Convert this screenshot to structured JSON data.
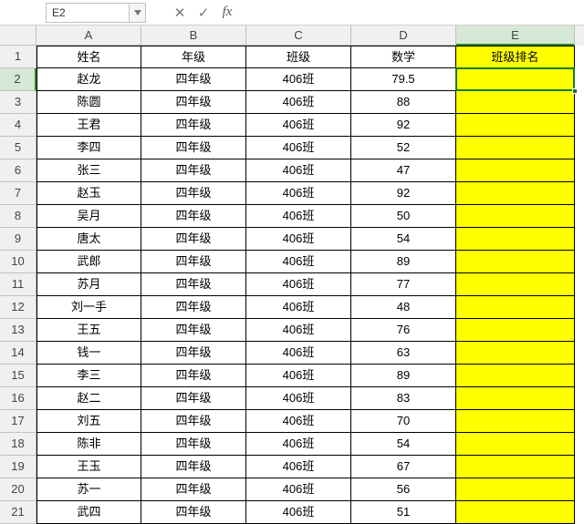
{
  "formula_bar": {
    "name_box": "E2",
    "cancel_glyph": "✕",
    "accept_glyph": "✓",
    "fx_label": "fx",
    "formula": ""
  },
  "columns": [
    "A",
    "B",
    "C",
    "D",
    "E"
  ],
  "selected_col": 4,
  "selected_row": 1,
  "headers": [
    "姓名",
    "年级",
    "班级",
    "数学",
    "班级排名"
  ],
  "rows": [
    {
      "n": "赵龙",
      "g": "四年级",
      "c": "406班",
      "m": "79.5",
      "r": ""
    },
    {
      "n": "陈圆",
      "g": "四年级",
      "c": "406班",
      "m": "88",
      "r": ""
    },
    {
      "n": "王君",
      "g": "四年级",
      "c": "406班",
      "m": "92",
      "r": ""
    },
    {
      "n": "李四",
      "g": "四年级",
      "c": "406班",
      "m": "52",
      "r": ""
    },
    {
      "n": "张三",
      "g": "四年级",
      "c": "406班",
      "m": "47",
      "r": ""
    },
    {
      "n": "赵玉",
      "g": "四年级",
      "c": "406班",
      "m": "92",
      "r": ""
    },
    {
      "n": "吴月",
      "g": "四年级",
      "c": "406班",
      "m": "50",
      "r": ""
    },
    {
      "n": "唐太",
      "g": "四年级",
      "c": "406班",
      "m": "54",
      "r": ""
    },
    {
      "n": "武郎",
      "g": "四年级",
      "c": "406班",
      "m": "89",
      "r": ""
    },
    {
      "n": "苏月",
      "g": "四年级",
      "c": "406班",
      "m": "77",
      "r": ""
    },
    {
      "n": "刘一手",
      "g": "四年级",
      "c": "406班",
      "m": "48",
      "r": ""
    },
    {
      "n": "王五",
      "g": "四年级",
      "c": "406班",
      "m": "76",
      "r": ""
    },
    {
      "n": "钱一",
      "g": "四年级",
      "c": "406班",
      "m": "63",
      "r": ""
    },
    {
      "n": "李三",
      "g": "四年级",
      "c": "406班",
      "m": "89",
      "r": ""
    },
    {
      "n": "赵二",
      "g": "四年级",
      "c": "406班",
      "m": "83",
      "r": ""
    },
    {
      "n": "刘五",
      "g": "四年级",
      "c": "406班",
      "m": "70",
      "r": ""
    },
    {
      "n": "陈非",
      "g": "四年级",
      "c": "406班",
      "m": "54",
      "r": ""
    },
    {
      "n": "王玉",
      "g": "四年级",
      "c": "406班",
      "m": "67",
      "r": ""
    },
    {
      "n": "苏一",
      "g": "四年级",
      "c": "406班",
      "m": "56",
      "r": ""
    },
    {
      "n": "武四",
      "g": "四年级",
      "c": "406班",
      "m": "51",
      "r": ""
    }
  ],
  "active_cell": {
    "col": "E",
    "row": 2
  }
}
